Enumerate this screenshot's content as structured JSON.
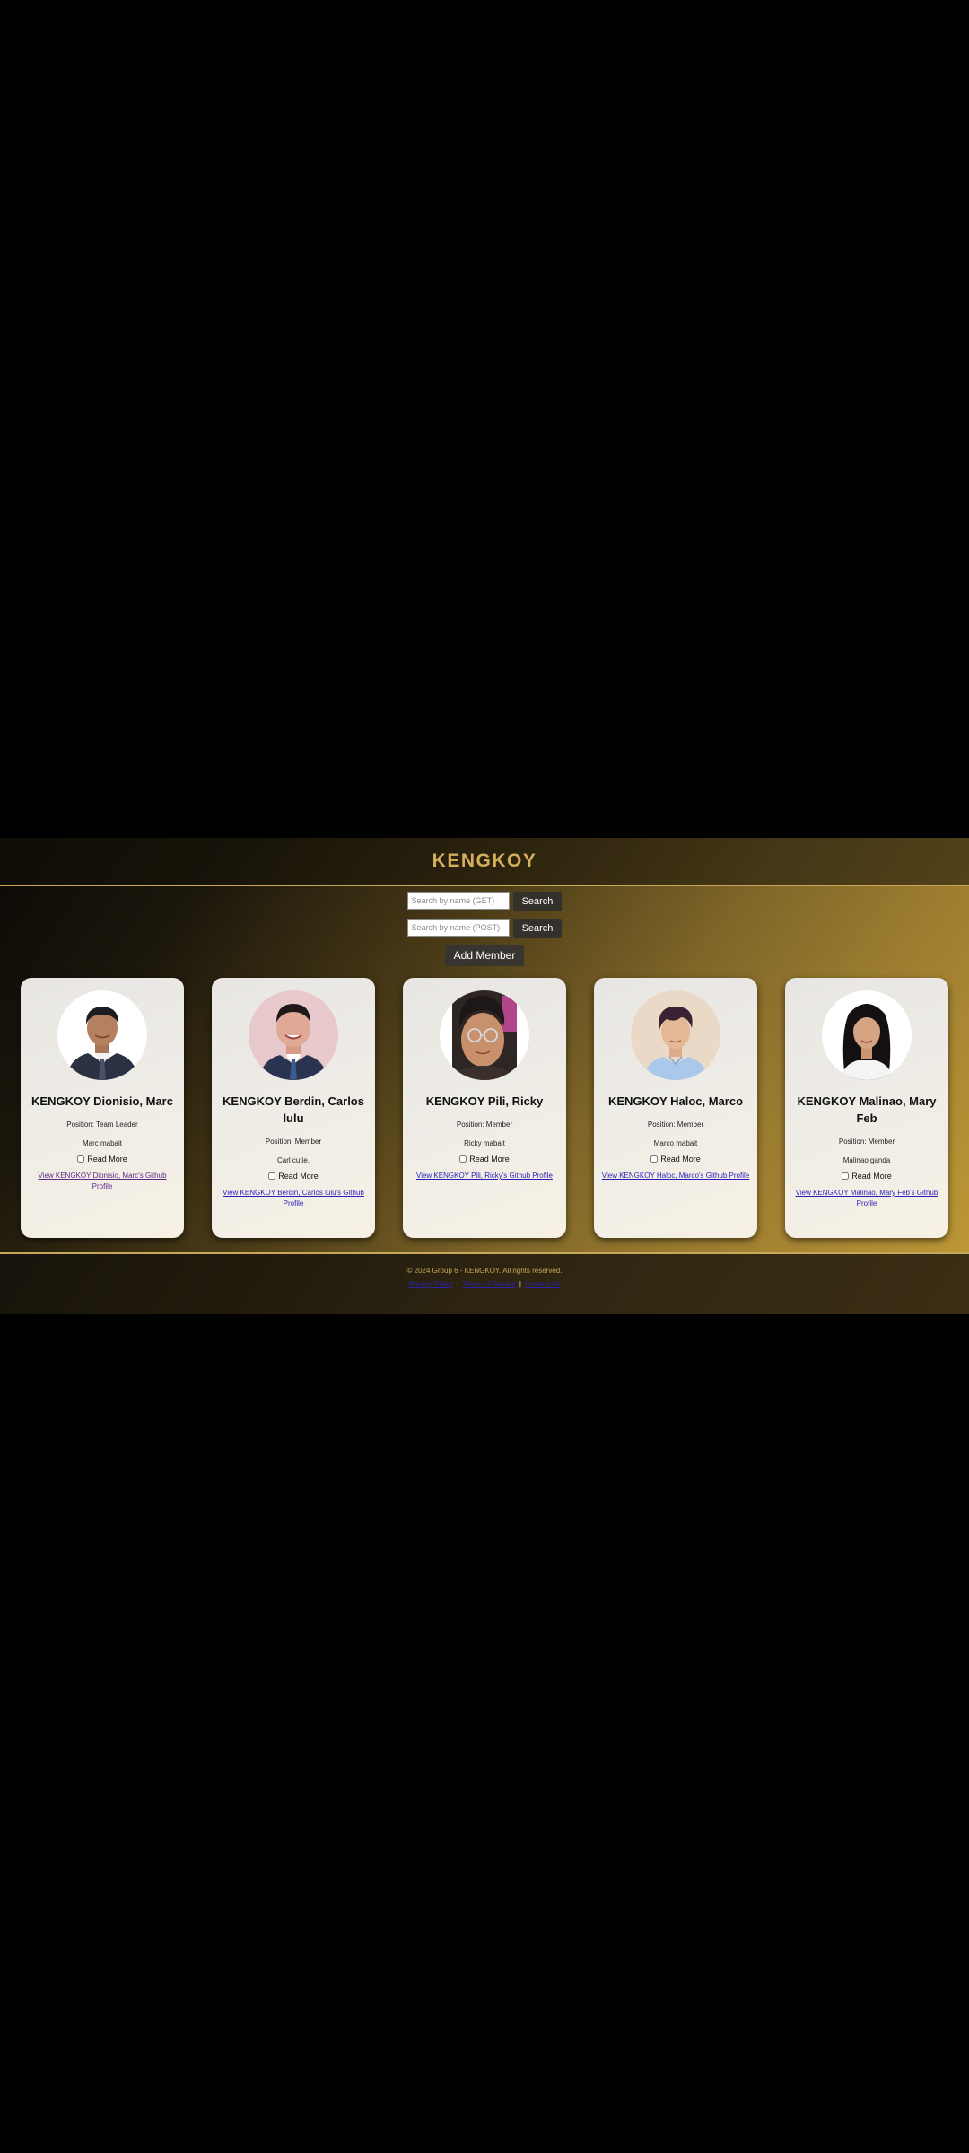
{
  "header": {
    "title": "KENGKOY"
  },
  "search": {
    "get_placeholder": "Search by name (GET)",
    "post_placeholder": "Search by name (POST)",
    "get_button": "Search",
    "post_button": "Search"
  },
  "actions": {
    "add_member": "Add Member"
  },
  "members": [
    {
      "name": "KENGKOY Dionisio, Marc",
      "position": "Position: Team Leader",
      "bio": "Marc mabait",
      "read_more": "Read More",
      "link": "View KENGKOY Dionisio, Marc's Github Profile"
    },
    {
      "name": "KENGKOY Berdin, Carlos lulu",
      "position": "Position: Member",
      "bio": "Carl cutie.",
      "read_more": "Read More",
      "link": "View KENGKOY Berdin, Carlos lulu's Github Profile"
    },
    {
      "name": "KENGKOY Pili, Ricky",
      "position": "Position: Member",
      "bio": "Ricky mabait",
      "read_more": "Read More",
      "link": "View KENGKOY Pili, Ricky's Github Profile"
    },
    {
      "name": "KENGKOY Haloc, Marco",
      "position": "Position: Member",
      "bio": "Marco mabait",
      "read_more": "Read More",
      "link": "View KENGKOY Haloc, Marco's Github Profile"
    },
    {
      "name": "KENGKOY Malinao, Mary Feb",
      "position": "Position: Member",
      "bio": "Malinao ganda",
      "read_more": "Read More",
      "link": "View KENGKOY Malinao, Mary Feb's Github Profile"
    }
  ],
  "footer": {
    "copyright": "© 2024 Group 6 - KENGKOY. All rights reserved.",
    "links": [
      "Privacy Policy",
      "Terms of Service",
      "Contact Us"
    ]
  },
  "colors": {
    "accent_gold": "#d4ae5a",
    "border_gold": "#c9a758",
    "link_blue": "#2b1fb8",
    "button_dark": "#34302b"
  }
}
